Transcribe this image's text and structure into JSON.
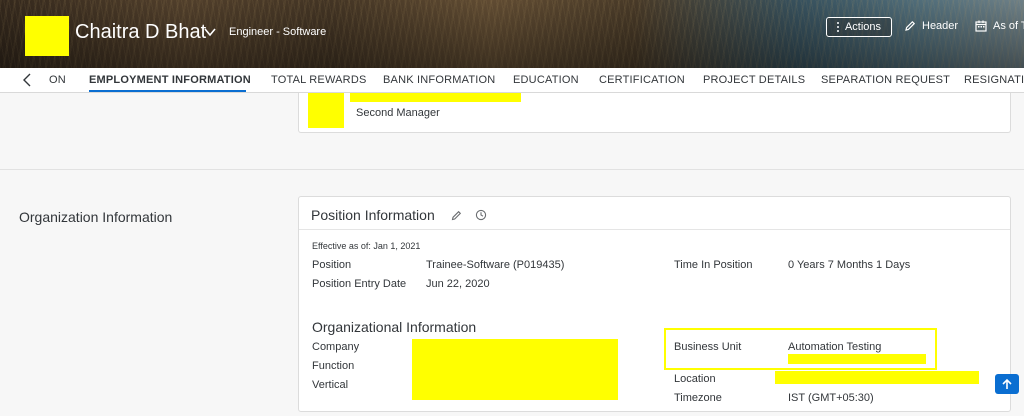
{
  "header": {
    "employee_name": "Chaitra D Bhat",
    "job_title": "Engineer - Software",
    "actions_label": "Actions",
    "header_label": "Header",
    "as_of_label": "As of T"
  },
  "tabs": [
    {
      "label": "ON"
    },
    {
      "label": "EMPLOYMENT INFORMATION",
      "active": true
    },
    {
      "label": "TOTAL REWARDS"
    },
    {
      "label": "BANK INFORMATION"
    },
    {
      "label": "EDUCATION"
    },
    {
      "label": "CERTIFICATION"
    },
    {
      "label": "PROJECT DETAILS"
    },
    {
      "label": "SEPARATION REQUEST"
    },
    {
      "label": "RESIGNATI"
    }
  ],
  "top_card": {
    "second_manager_label": "Second Manager"
  },
  "organization_section": {
    "label": "Organization Information"
  },
  "position_card": {
    "title": "Position Information",
    "effective_as_of": "Effective as of: Jan 1, 2021",
    "position_label": "Position",
    "position_value": "Trainee-Software (P019435)",
    "entry_date_label": "Position Entry Date",
    "entry_date_value": "Jun 22, 2020",
    "time_in_position_label": "Time In Position",
    "time_in_position_value": "0 Years 7 Months 1 Days",
    "org_info_title": "Organizational Information",
    "company_label": "Company",
    "function_label": "Function",
    "vertical_label": "Vertical",
    "business_unit_label": "Business Unit",
    "business_unit_value": "Automation Testing",
    "location_label": "Location",
    "timezone_label": "Timezone",
    "timezone_value": "IST (GMT+05:30)"
  },
  "colors": {
    "accent": "#0a6ed1",
    "redaction": "#ffff00",
    "text": "#32363a"
  },
  "icons": [
    "chevron-down-icon",
    "kebab-icon",
    "pencil-icon",
    "calendar-icon",
    "chevron-left-icon",
    "edit-icon",
    "history-icon",
    "arrow-up-icon"
  ]
}
